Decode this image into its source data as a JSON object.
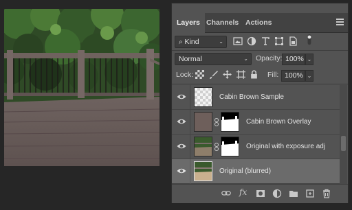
{
  "tabs": [
    {
      "label": "Layers",
      "active": true
    },
    {
      "label": "Channels",
      "active": false
    },
    {
      "label": "Actions",
      "active": false
    }
  ],
  "filter": {
    "kind_label": "Kind",
    "icons": [
      "image-filter-icon",
      "adjustment-filter-icon",
      "type-filter-icon",
      "shape-filter-icon",
      "smart-object-filter-icon",
      "filter-toggle-icon"
    ]
  },
  "blend": {
    "mode": "Normal",
    "opacity_label": "Opacity:",
    "opacity_value": "100%"
  },
  "lock": {
    "label": "Lock:",
    "icons": [
      "lock-transparent-pixels-icon",
      "lock-image-pixels-icon",
      "lock-position-icon",
      "lock-artboard-icon",
      "lock-all-icon"
    ],
    "fill_label": "Fill:",
    "fill_value": "100%"
  },
  "layers": [
    {
      "name": "Cabin Brown Sample",
      "visible": true,
      "selected": false,
      "thumb": "transparent",
      "mask": false
    },
    {
      "name": "Cabin Brown Overlay",
      "visible": true,
      "selected": false,
      "thumb": "brown",
      "mask": true
    },
    {
      "name": "Original with exposure adj",
      "visible": true,
      "selected": false,
      "thumb": "photo",
      "mask": true
    },
    {
      "name": "Original (blurred)",
      "visible": true,
      "selected": true,
      "thumb": "photo",
      "mask": false
    }
  ],
  "footer_icons": [
    "link-layers-icon",
    "fx-icon",
    "add-mask-icon",
    "adjustment-layer-icon",
    "new-group-icon",
    "new-layer-icon",
    "trash-icon"
  ],
  "colors": {
    "panel_bg": "#535353",
    "selected_row": "#6b6b6b",
    "brown_swatch": "#6e5f5b"
  }
}
